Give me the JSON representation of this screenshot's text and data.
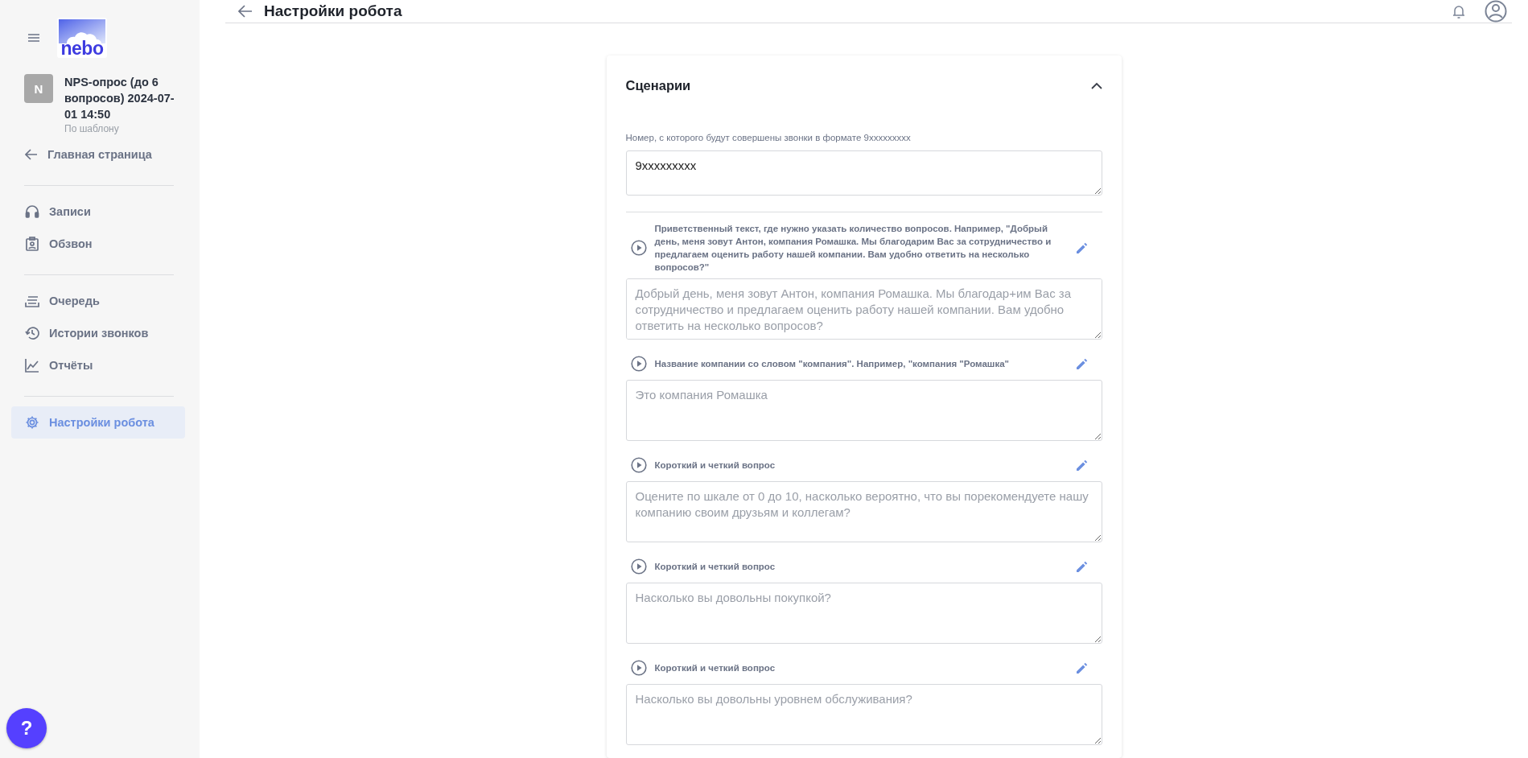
{
  "sidebar": {
    "logo": "nebo",
    "project": {
      "avatar": "N",
      "name": "NPS-опрос (до 6 вопросов) 2024-07-01 14:50",
      "subtitle": "По шаблону"
    },
    "back_link": "Главная страница",
    "nav_groups": [
      [
        {
          "label": "Записи",
          "selected": false
        },
        {
          "label": "Обзвон",
          "selected": false
        }
      ],
      [
        {
          "label": "Очередь",
          "selected": false
        },
        {
          "label": "Истории звонков",
          "selected": false
        },
        {
          "label": "Отчёты",
          "selected": false
        }
      ],
      [
        {
          "label": "Настройки робота",
          "selected": true
        }
      ]
    ],
    "help_button": "?"
  },
  "header": {
    "title": "Настройки робота"
  },
  "card": {
    "title": "Сценарии",
    "expanded": true,
    "phone_field": {
      "label": "Номер, с которого будут совершены звонки в формате 9xxxxxxxxx",
      "value": "9xxxxxxxxx"
    },
    "prompts": [
      {
        "label": "Приветственный текст, где нужно указать количество вопросов. Например, \"Добрый день, меня зовут Антон, компания Ромашка. Мы благодарим Вас за сотрудничество и предлагаем оценить работу нашей компании. Вам удобно ответить на несколько вопросов?\"",
        "placeholder": "Добрый день, меня зовут Антон, компания Ромашка. Мы благодар+им Вас за сотрудничество и предлагаем оценить работу нашей компании. Вам удобно ответить на несколько вопросов?"
      },
      {
        "label": "Название компании со словом \"компания\". Например, \"компания \"Ромашка\"",
        "placeholder": "Это компания Ромашка"
      },
      {
        "label": "Короткий и четкий вопрос",
        "placeholder": "Оцените по шкале от 0 до 10, насколько вероятно, что вы порекомендуете нашу компанию своим друзьям и коллегам?"
      },
      {
        "label": "Короткий и четкий вопрос",
        "placeholder": "Насколько вы довольны покупкой?"
      },
      {
        "label": "Короткий и четкий вопрос",
        "placeholder": "Насколько вы довольны уровнем обслуживания?"
      }
    ]
  }
}
